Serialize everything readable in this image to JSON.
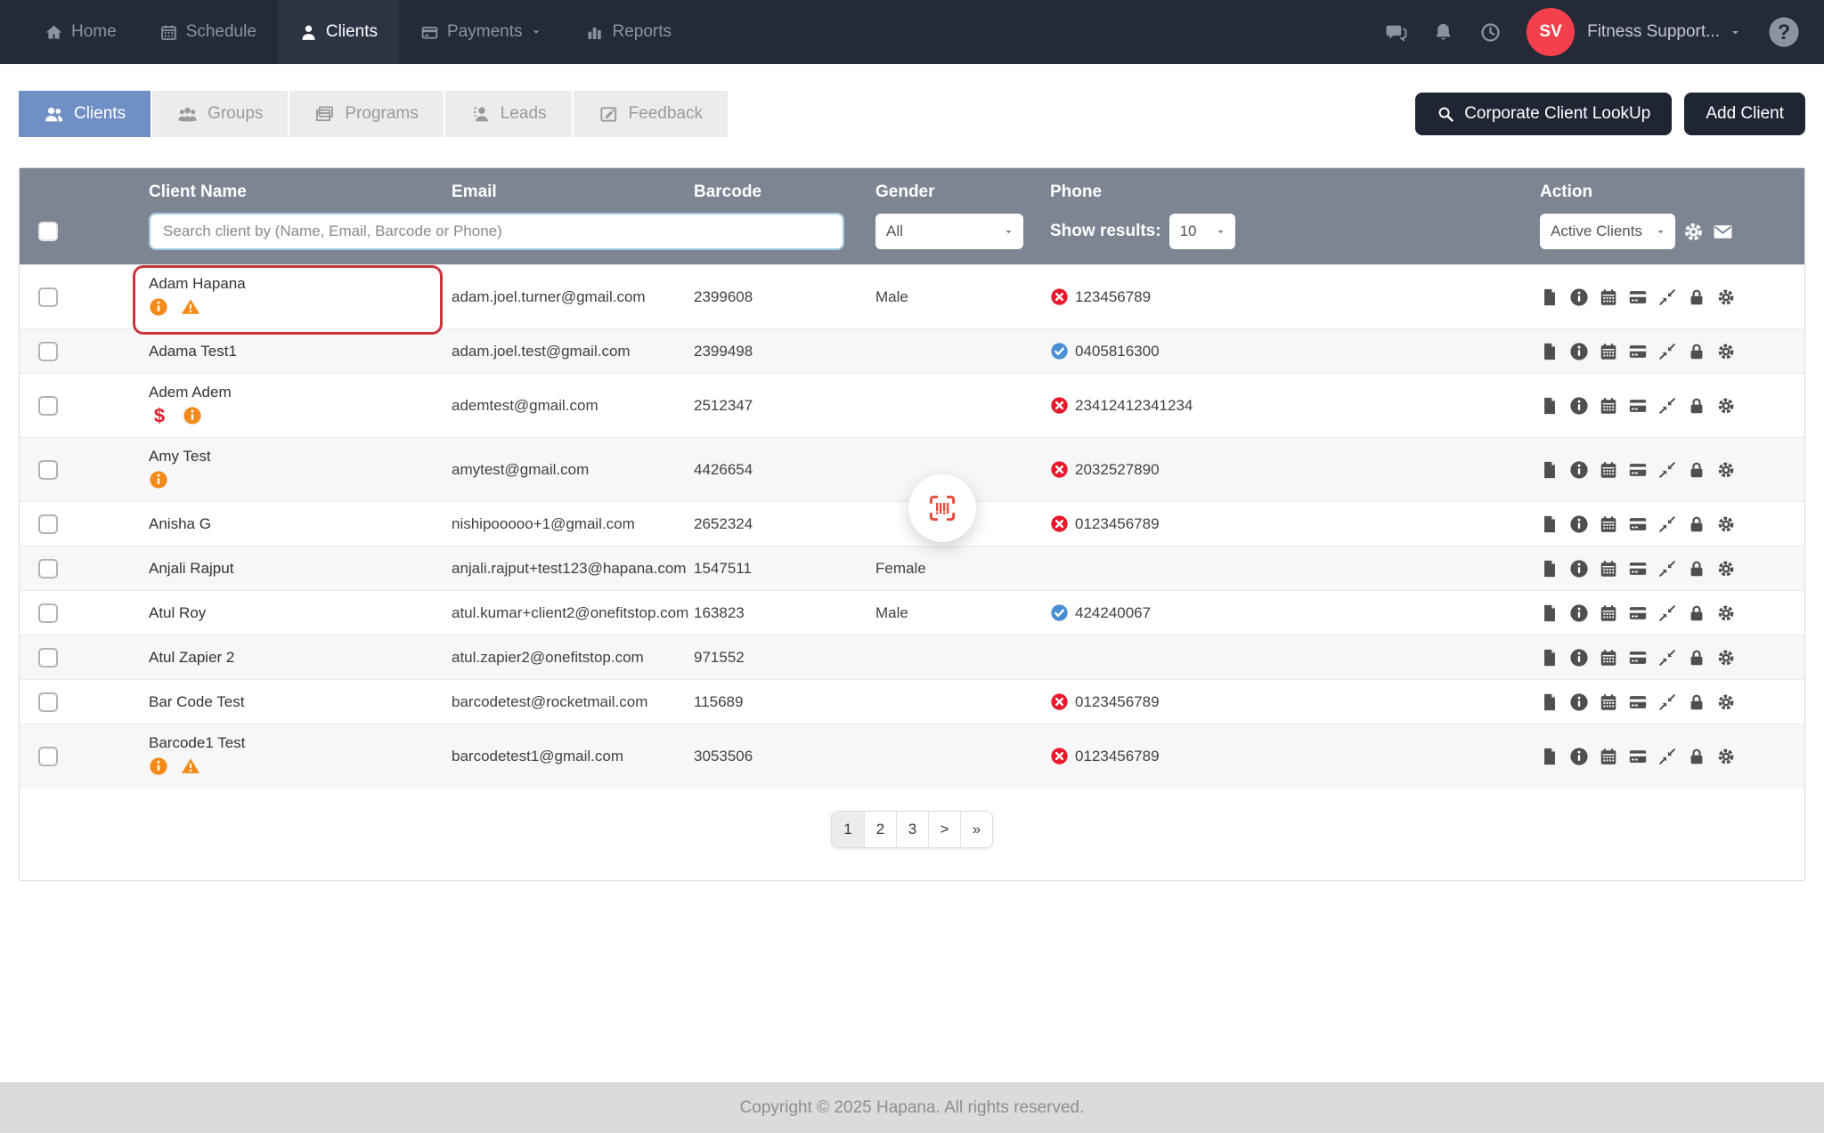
{
  "navbar": {
    "items": [
      {
        "label": "Home",
        "icon": "home"
      },
      {
        "label": "Schedule",
        "icon": "calendar"
      },
      {
        "label": "Clients",
        "icon": "person",
        "active": true
      },
      {
        "label": "Payments",
        "icon": "credit-card",
        "has_dropdown": true
      },
      {
        "label": "Reports",
        "icon": "bar-chart"
      }
    ],
    "right_icons": [
      "chat",
      "bell",
      "clock",
      "help"
    ],
    "user": {
      "initials": "SV",
      "name": "Fitness Support...",
      "avatar_color": "#f4404d"
    }
  },
  "tabs": [
    {
      "label": "Clients",
      "icon": "users-two",
      "active": true
    },
    {
      "label": "Groups",
      "icon": "users-three"
    },
    {
      "label": "Programs",
      "icon": "window-cards"
    },
    {
      "label": "Leads",
      "icon": "person-sparkle"
    },
    {
      "label": "Feedback",
      "icon": "note-pencil"
    }
  ],
  "toolbar": {
    "corporate_lookup_label": "Corporate Client LookUp",
    "add_client_label": "Add Client"
  },
  "table": {
    "columns": [
      "Client Name",
      "Email",
      "Barcode",
      "Gender",
      "Phone",
      "Action"
    ],
    "filters": {
      "search_placeholder": "Search client by (Name, Email, Barcode or Phone)",
      "gender_value": "All",
      "show_results_label": "Show results:",
      "show_results_value": "10",
      "status_value": "Active Clients"
    },
    "rows": [
      {
        "name": "Adam Hapana",
        "email": "adam.joel.turner@gmail.com",
        "barcode": "2399608",
        "gender": "Male",
        "phone": "123456789",
        "phone_status": "invalid",
        "badges": [
          "info-circle",
          "warning-triangle"
        ],
        "highlighted": true
      },
      {
        "name": "Adama Test1",
        "email": "adam.joel.test@gmail.com",
        "barcode": "2399498",
        "gender": "",
        "phone": "0405816300",
        "phone_status": "verified",
        "badges": []
      },
      {
        "name": "Adem Adem",
        "email": "ademtest@gmail.com",
        "barcode": "2512347",
        "gender": "",
        "phone": "23412412341234",
        "phone_status": "invalid",
        "badges": [
          "dollar-sign",
          "info-circle"
        ]
      },
      {
        "name": "Amy Test",
        "email": "amytest@gmail.com",
        "barcode": "4426654",
        "gender": "",
        "phone": "2032527890",
        "phone_status": "invalid",
        "badges": [
          "info-circle"
        ]
      },
      {
        "name": "Anisha G",
        "email": "nishipooooo+1@gmail.com",
        "barcode": "2652324",
        "gender": "",
        "phone": "0123456789",
        "phone_status": "invalid",
        "badges": []
      },
      {
        "name": "Anjali Rajput",
        "email": "anjali.rajput+test123@hapana.com",
        "barcode": "1547511",
        "gender": "Female",
        "phone": "",
        "phone_status": "",
        "badges": []
      },
      {
        "name": "Atul Roy",
        "email": "atul.kumar+client2@onefitstop.com",
        "barcode": "163823",
        "gender": "Male",
        "phone": "424240067",
        "phone_status": "verified",
        "badges": []
      },
      {
        "name": "Atul Zapier 2",
        "email": "atul.zapier2@onefitstop.com",
        "barcode": "971552",
        "gender": "",
        "phone": "",
        "phone_status": "",
        "badges": []
      },
      {
        "name": "Bar Code Test",
        "email": "barcodetest@rocketmail.com",
        "barcode": "115689",
        "gender": "",
        "phone": "0123456789",
        "phone_status": "invalid",
        "badges": []
      },
      {
        "name": "Barcode1 Test",
        "email": "barcodetest1@gmail.com",
        "barcode": "3053506",
        "gender": "",
        "phone": "0123456789",
        "phone_status": "invalid",
        "badges": [
          "info-circle",
          "warning-triangle"
        ]
      }
    ],
    "action_icons": [
      "file",
      "info-circle",
      "calendar",
      "credit-card",
      "compress-arrows",
      "lock",
      "gear"
    ],
    "header_tool_icons": [
      "gear",
      "envelope"
    ]
  },
  "icons": {
    "phone_invalid": "x-circle",
    "phone_verified": "check-circle",
    "floating_button": "barcode-scan"
  },
  "pagination": {
    "items": [
      "1",
      "2",
      "3",
      ">",
      "»"
    ],
    "active": "1"
  },
  "footer": {
    "copyright": "Copyright © 2025 Hapana. All rights reserved."
  },
  "colors": {
    "navbar_bg": "#242a38",
    "tab_active": "#7090c5",
    "table_header": "#7d8592",
    "alert_orange": "#f28b1c",
    "alert_red": "#e8192c",
    "verified_blue": "#4a8fd4",
    "highlight_ring": "#c8353e",
    "avatar_red": "#f4404d"
  }
}
